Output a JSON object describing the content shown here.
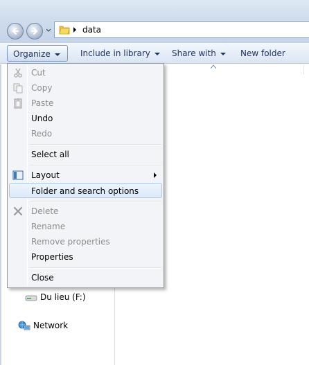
{
  "address": {
    "path": "data",
    "back_icon": "back-arrow-icon",
    "forward_icon": "forward-arrow-icon",
    "folder_icon": "folder-icon"
  },
  "toolbar": {
    "organize_label": "Organize",
    "include_label": "Include in library",
    "share_label": "Share with",
    "new_folder_label": "New folder"
  },
  "menu": {
    "cut": "Cut",
    "copy": "Copy",
    "paste": "Paste",
    "undo": "Undo",
    "redo": "Redo",
    "select_all": "Select all",
    "layout": "Layout",
    "folder_options": "Folder and search options",
    "delete": "Delete",
    "rename": "Rename",
    "remove_properties": "Remove properties",
    "properties": "Properties",
    "close": "Close"
  },
  "navpane": {
    "drive_label": "Du lieu (F:)",
    "network_label": "Network"
  },
  "colors": {
    "command_text": "#1e3560",
    "disabled_text": "#8d8d8d",
    "menu_bg": "#f3f4f7",
    "hover_border": "#a9c9ef"
  }
}
